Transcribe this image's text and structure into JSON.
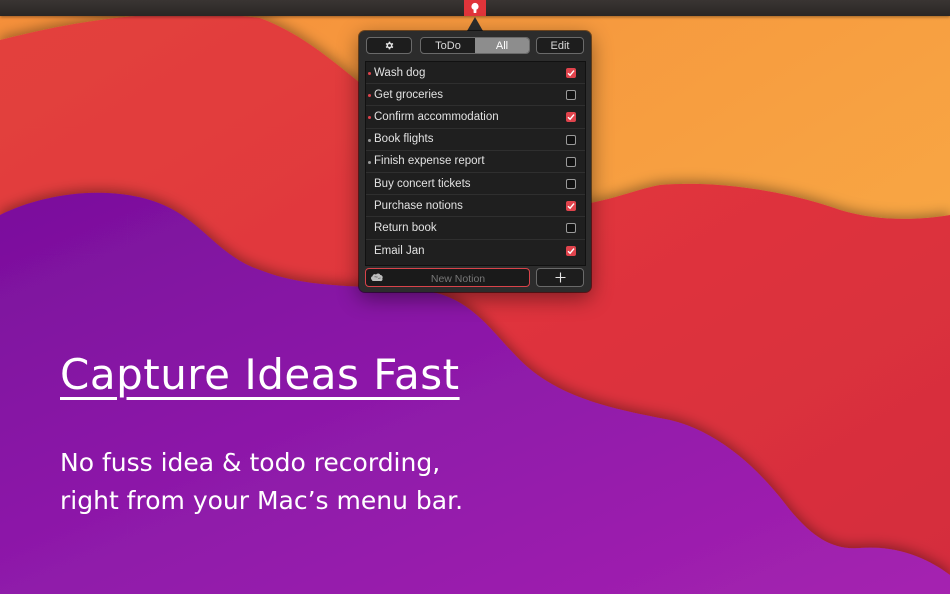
{
  "toolbar": {
    "settings_icon": "gear-icon",
    "filter_options": [
      "ToDo",
      "All"
    ],
    "selected_filter": "All",
    "edit_label": "Edit"
  },
  "items": [
    {
      "label": "Wash dog",
      "checked": true,
      "priority": true
    },
    {
      "label": "Get groceries",
      "checked": false,
      "priority": true
    },
    {
      "label": "Confirm accommodation",
      "checked": true,
      "priority": true
    },
    {
      "label": "Book flights",
      "checked": false,
      "priority": true
    },
    {
      "label": "Finish expense report",
      "checked": false,
      "priority": true
    },
    {
      "label": "Buy concert tickets",
      "checked": false,
      "priority": false
    },
    {
      "label": "Purchase notions",
      "checked": true,
      "priority": false
    },
    {
      "label": "Return book",
      "checked": false,
      "priority": false
    },
    {
      "label": "Email Jan",
      "checked": true,
      "priority": false
    }
  ],
  "new_notion": {
    "placeholder": "New Notion",
    "value": "",
    "icon": "brain-icon",
    "add_icon": "plus-icon"
  },
  "marketing": {
    "headline": "Capture Ideas Fast",
    "tagline_line1": "No fuss idea & todo recording,",
    "tagline_line2": "right from your Mac’s menu bar."
  },
  "colors": {
    "accent": "#e0434c",
    "menubar_icon_bg": "#e0343a",
    "priority_dot_red": "#e0434c",
    "priority_dot_gray": "#9a9a9a",
    "wallpaper_orange": "#f7a33d",
    "wallpaper_red": "#e0333f",
    "wallpaper_purple": "#8e1aa6"
  }
}
